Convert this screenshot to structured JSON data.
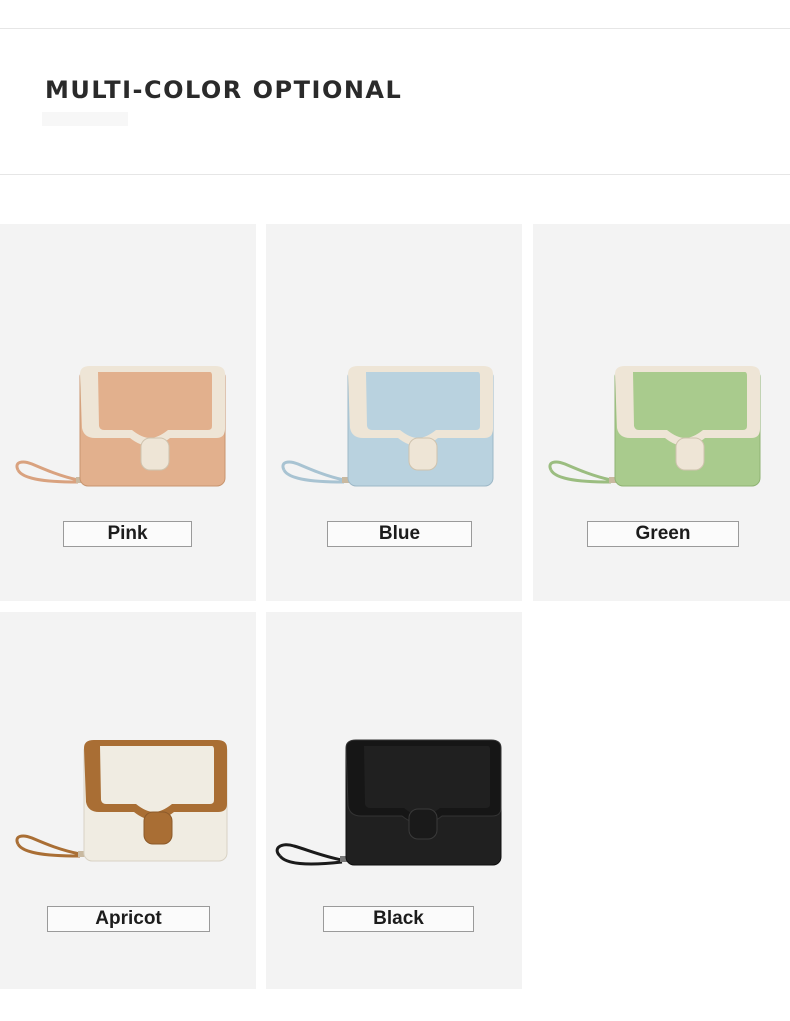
{
  "header": {
    "title": "MULTI-COLOR OPTIONAL"
  },
  "products": [
    {
      "name": "Pink",
      "colors": {
        "body": "#e2b08d",
        "trim": "#eee5d6",
        "strap": "#d9a27f"
      }
    },
    {
      "name": "Blue",
      "colors": {
        "body": "#b9d2df",
        "trim": "#eee5d6",
        "strap": "#a8c3d2"
      }
    },
    {
      "name": "Green",
      "colors": {
        "body": "#a9cb8d",
        "trim": "#eee5d6",
        "strap": "#9bbd80"
      }
    },
    {
      "name": "Apricot",
      "colors": {
        "body": "#f0ece2",
        "trim": "#a96e34",
        "strap": "#a96e34"
      }
    },
    {
      "name": "Black",
      "colors": {
        "body": "#202020",
        "trim": "#161616",
        "strap": "#1a1a1a"
      }
    }
  ]
}
